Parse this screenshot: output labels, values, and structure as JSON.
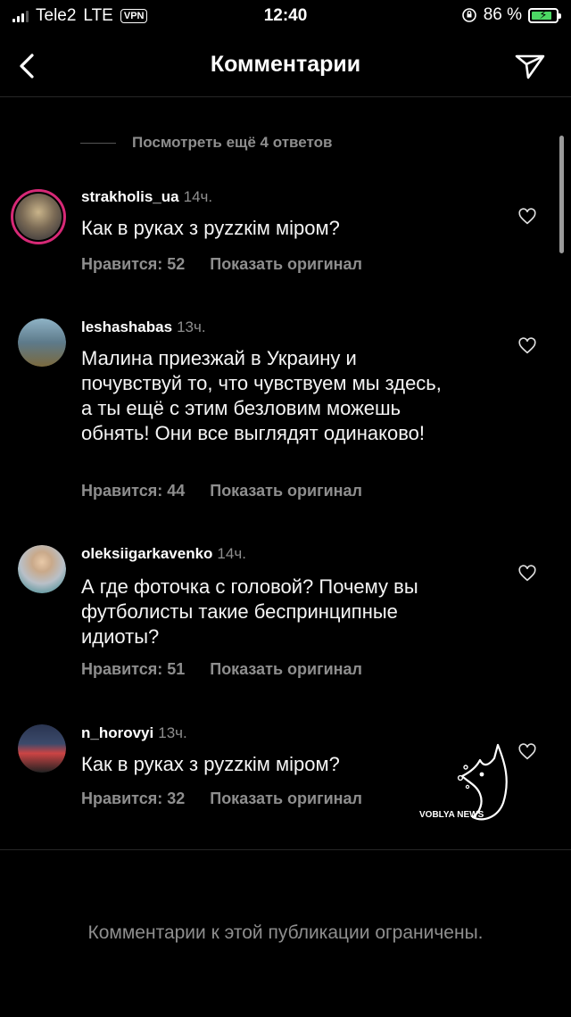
{
  "status_bar": {
    "carrier": "Tele2",
    "network": "LTE",
    "vpn": "VPN",
    "time": "12:40",
    "battery": "86 %",
    "battery_level": 0.86
  },
  "header": {
    "title": "Комментарии",
    "back_icon": "chevron-left-icon",
    "send_icon": "paper-plane-icon"
  },
  "view_more": "Посмотреть ещё 4 ответов",
  "comments": [
    {
      "username": "strakholis_ua",
      "time": "14ч.",
      "text": "Как в руках з руzzкім міром?",
      "likes": "Нравится: 52",
      "show_original": "Показать оригинал",
      "avatar_color": "#7a6a55"
    },
    {
      "username": "leshashabas",
      "time": "13ч.",
      "text": "Малина приезжай в Украину и почувствуй то, что чувствуем мы здесь, а ты ещё с этим безловим можешь обнять! Они все выглядят одинаково!",
      "likes": "Нравится: 44",
      "show_original": "Показать оригинал",
      "avatar_color": "#5d7a8a"
    },
    {
      "username": "oleksiigarkavenko",
      "time": "14ч.",
      "text": "А где фоточка с головой? Почему вы футболисты такие беспринципные идиоты?",
      "likes": "Нравится: 51",
      "show_original": "Показать оригинал",
      "avatar_color": "#b9c0c8"
    },
    {
      "username": "n_horovyi",
      "time": "13ч.",
      "text": "Как в руках з руzzкім міром?",
      "likes": "Нравится: 32",
      "show_original": "Показать оригинал",
      "avatar_color": "#3b4a6b"
    }
  ],
  "watermark": "VOBLYA NEWS",
  "footer": "Комментарии к этой публикации ограничены."
}
